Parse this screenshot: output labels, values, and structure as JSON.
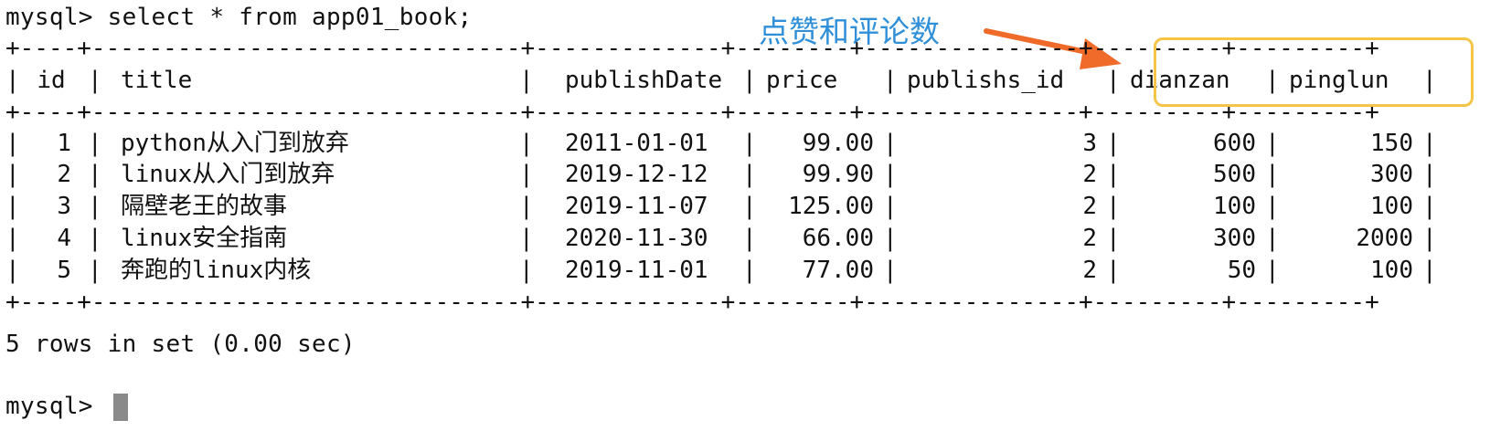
{
  "terminal": {
    "command_line": "mysql> select * from app01_book;",
    "summary": "5 rows in set (0.00 sec)",
    "prompt": "mysql> "
  },
  "annotation": {
    "text": "点赞和评论数",
    "color": "#2f8fd8",
    "arrow_color": "#f06a2a",
    "highlight_color": "#f5c54a"
  },
  "table": {
    "headers": [
      "id",
      "title",
      "publishDate",
      "price",
      "publishs_id",
      "dianzan",
      "pinglun"
    ],
    "rows": [
      {
        "id": "1",
        "title": "python从入门到放弃",
        "publishDate": "2011-01-01",
        "price": "99.00",
        "publishs_id": "3",
        "dianzan": "600",
        "pinglun": "150"
      },
      {
        "id": "2",
        "title": "linux从入门到放弃",
        "publishDate": "2019-12-12",
        "price": "99.90",
        "publishs_id": "2",
        "dianzan": "500",
        "pinglun": "300"
      },
      {
        "id": "3",
        "title": "隔壁老王的故事",
        "publishDate": "2019-11-07",
        "price": "125.00",
        "publishs_id": "2",
        "dianzan": "100",
        "pinglun": "100"
      },
      {
        "id": "4",
        "title": "linux安全指南",
        "publishDate": "2020-11-30",
        "price": "66.00",
        "publishs_id": "2",
        "dianzan": "300",
        "pinglun": "2000"
      },
      {
        "id": "5",
        "title": "奔跑的linux内核",
        "publishDate": "2019-11-01",
        "price": "77.00",
        "publishs_id": "2",
        "dianzan": "50",
        "pinglun": "100"
      }
    ]
  }
}
